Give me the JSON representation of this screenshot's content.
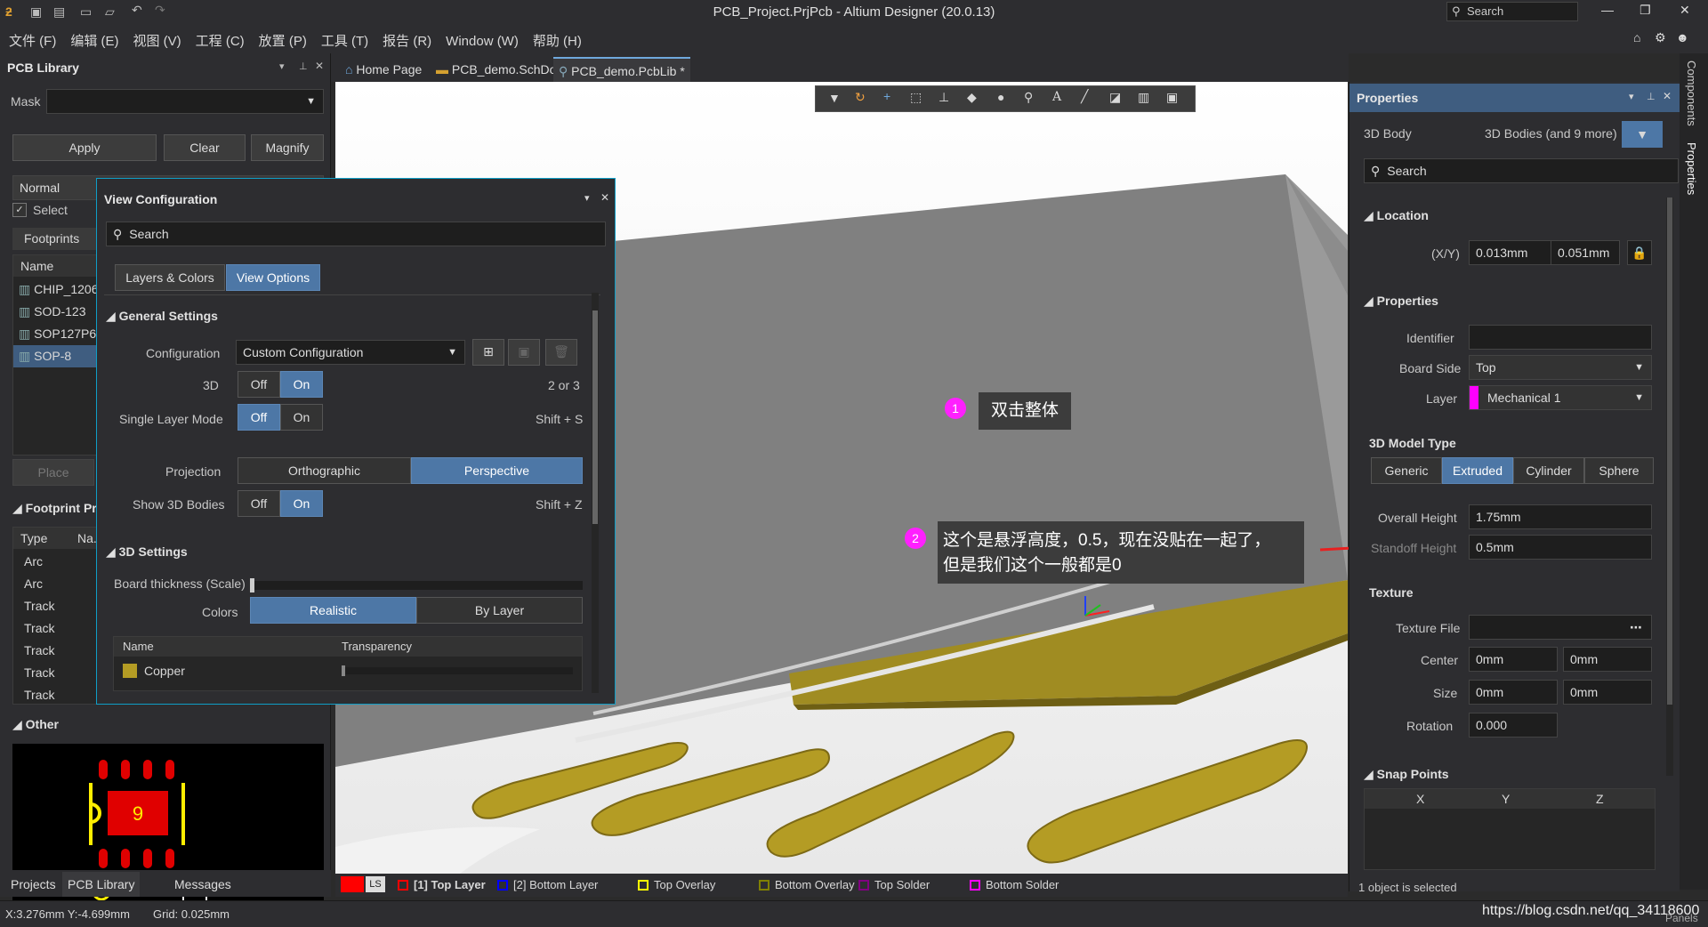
{
  "window": {
    "title": "PCB_Project.PrjPcb - Altium Designer (20.0.13)",
    "search_placeholder": "Search"
  },
  "menu": [
    "文件 (F)",
    "编辑 (E)",
    "视图 (V)",
    "工程 (C)",
    "放置 (P)",
    "工具 (T)",
    "报告 (R)",
    "Window (W)",
    "帮助 (H)"
  ],
  "doc_tabs": [
    "Home Page",
    "PCB_demo.SchDoc",
    "PCB_demo.PcbLib *"
  ],
  "pcb_library": {
    "title": "PCB Library",
    "mask_label": "Mask",
    "apply": "Apply",
    "clear": "Clear",
    "magnify": "Magnify",
    "normal": "Normal",
    "select": "Select",
    "footprints_header": "Footprints",
    "name_col": "Name",
    "footprints": [
      "CHIP_1206",
      "SOD-123",
      "SOP127P6",
      "SOP-8"
    ],
    "place": "Place",
    "footprint_primitives": "Footprint Pri",
    "type_col": "Type",
    "na_col": "Na.",
    "primitives": [
      "Arc",
      "Arc",
      "Track",
      "Track",
      "Track",
      "Track",
      "Track"
    ],
    "other": "Other",
    "preview_pad": "9"
  },
  "view_config": {
    "title": "View Configuration",
    "search": "Search",
    "tab_layers": "Layers & Colors",
    "tab_view": "View Options",
    "general": "General Settings",
    "configuration_label": "Configuration",
    "configuration_value": "Custom Configuration",
    "three_d_label": "3D",
    "off": "Off",
    "on": "On",
    "three_d_shortcut": "2 or 3",
    "single_layer": "Single Layer Mode",
    "single_shortcut": "Shift + S",
    "projection": "Projection",
    "ortho": "Orthographic",
    "persp": "Perspective",
    "show3d": "Show 3D Bodies",
    "show3d_shortcut": "Shift + Z",
    "settings3d": "3D Settings",
    "board_thickness": "Board thickness (Scale)",
    "colors": "Colors",
    "realistic": "Realistic",
    "by_layer": "By Layer",
    "name_col": "Name",
    "transparency_col": "Transparency",
    "copper": "Copper"
  },
  "annotations": {
    "n1": "1",
    "text1": "双击整体",
    "n2": "2",
    "text2_line1": "这个是悬浮高度，0.5，现在没贴在一起了，",
    "text2_line2": "但是我们这个一般都是0"
  },
  "properties": {
    "title": "Properties",
    "object": "3D Body",
    "filter": "3D Bodies (and 9 more)",
    "search": "Search",
    "location": "Location",
    "xy_label": "(X/Y)",
    "x": "0.013mm",
    "y": "0.051mm",
    "props": "Properties",
    "identifier": "Identifier",
    "board_side": "Board Side",
    "board_side_value": "Top",
    "layer": "Layer",
    "layer_value": "Mechanical 1",
    "model_type": "3D Model Type",
    "types": [
      "Generic",
      "Extruded",
      "Cylinder",
      "Sphere"
    ],
    "overall_height": "Overall Height",
    "overall_height_value": "1.75mm",
    "standoff": "Standoff Height",
    "standoff_value": "0.5mm",
    "texture": "Texture",
    "texture_file": "Texture File",
    "center": "Center",
    "center_x": "0mm",
    "center_y": "0mm",
    "size": "Size",
    "size_x": "0mm",
    "size_y": "0mm",
    "rotation": "Rotation",
    "rotation_value": "0.000",
    "snap": "Snap Points",
    "snap_x": "X",
    "snap_y": "Y",
    "snap_z": "Z",
    "selected": "1 object is selected"
  },
  "side_tabs": [
    "Components",
    "Properties"
  ],
  "bottom_tabs": [
    "Projects",
    "PCB Library",
    "Messages"
  ],
  "layers": [
    {
      "label": "LS",
      "color": "#ff0000"
    },
    {
      "label": "[1] Top Layer",
      "color": "#ff0000"
    },
    {
      "label": "[2] Bottom Layer",
      "color": "#0000ff"
    },
    {
      "label": "Top Overlay",
      "color": "#ffff00"
    },
    {
      "label": "Bottom Overlay",
      "color": "#808000"
    },
    {
      "label": "Top Solder",
      "color": "#800080"
    },
    {
      "label": "Bottom Solder",
      "color": "#ff00ff"
    }
  ],
  "status": {
    "coords": "X:3.276mm Y:-4.699mm",
    "grid": "Grid: 0.025mm",
    "watermark": "https://blog.csdn.net/qq_34118600",
    "panels": "Panels"
  }
}
